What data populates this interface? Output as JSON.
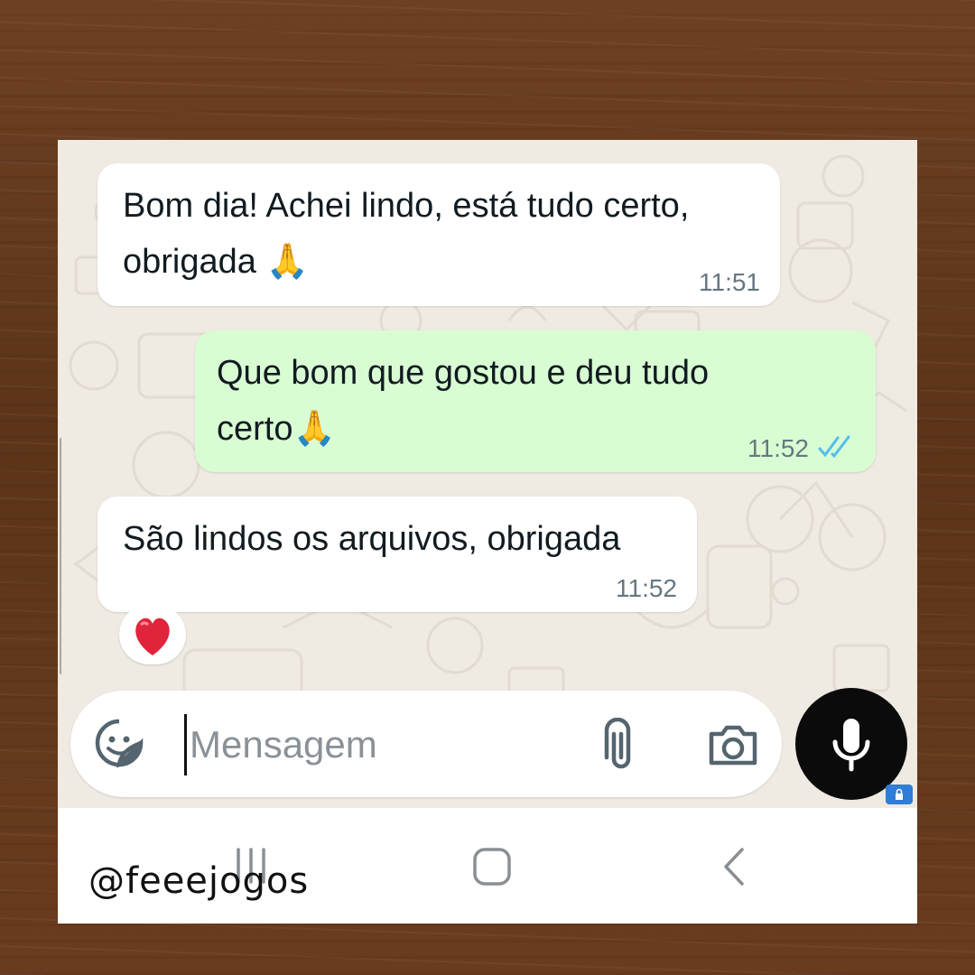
{
  "messages": [
    {
      "direction": "incoming",
      "lines": [
        "Bom dia! Achei lindo, está tudo certo,",
        "obrigada 🙏"
      ],
      "time": "11:51"
    },
    {
      "direction": "outgoing",
      "lines": [
        "Que bom que gostou e deu tudo",
        "certo🙏"
      ],
      "time": "11:52",
      "status": "read-double-check-icon"
    },
    {
      "direction": "incoming",
      "lines": [
        "São lindos os arquivos, obrigada"
      ],
      "time": "11:52",
      "reaction": "❤️"
    }
  ],
  "composer": {
    "placeholder": "Mensagem",
    "sticker_icon": "sticker-icon",
    "attach_icon": "paperclip-icon",
    "camera_icon": "camera-icon",
    "mic_icon": "microphone-icon"
  },
  "navbar": {
    "recents_icon": "recents-icon",
    "home_icon": "home-icon",
    "back_icon": "back-icon"
  },
  "watermark": "@feeejogos",
  "colors": {
    "incoming_bubble": "#ffffff",
    "outgoing_bubble": "#d9fdd3",
    "chat_background": "#efeae2",
    "read_ticks": "#53bdeb",
    "mic_button": "#0b0b0b"
  }
}
